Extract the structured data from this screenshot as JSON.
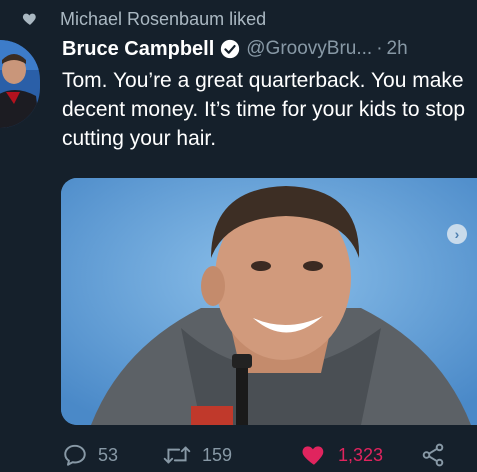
{
  "context": {
    "liked_by": "Michael Rosenbaum liked"
  },
  "tweet": {
    "display_name": "Bruce Campbell",
    "handle": "@GroovyBru...",
    "separator": "·",
    "time": "2h",
    "text": "Tom. You’re a great quarterback. You make decent money. It’s time for your kids to stop cutting your hair."
  },
  "actions": {
    "replies": "53",
    "retweets": "159",
    "likes": "1,323"
  },
  "icons": {
    "liked_heart": "heart-icon",
    "verified": "verified-badge-icon",
    "reply": "reply-icon",
    "retweet": "retweet-icon",
    "like": "like-icon",
    "share": "share-icon",
    "next": "next-arrow-icon"
  },
  "colors": {
    "background": "#15202b",
    "secondary_text": "#8899a6",
    "like_active": "#e0245e",
    "verified_fill": "#ffffff"
  }
}
